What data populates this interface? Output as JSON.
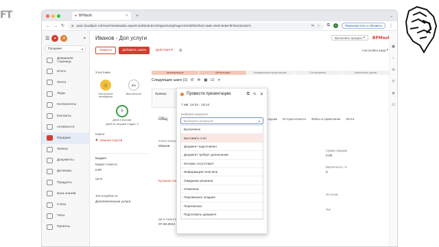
{
  "browser": {
    "tab_title": "BPMsoft",
    "url": "pwd.cloudbpm.ru/0%u0ViewModule.aspx#CardModuleV2/OpportunityPageV2/edit/f40cf643-4a8c-464b-9e66-f675223210a7c",
    "relaunch_label": "Перезапустить и обновить"
  },
  "sidebar": {
    "product_select": "Продажи",
    "items": [
      {
        "label": "Домашняя страница",
        "active": false
      },
      {
        "label": "Итоги",
        "active": false
      },
      {
        "label": "Лента",
        "active": false
      },
      {
        "label": "Лиды",
        "active": false
      },
      {
        "label": "Контрагенты",
        "active": false
      },
      {
        "label": "Контакты",
        "active": false
      },
      {
        "label": "Активности",
        "active": false
      },
      {
        "label": "Продажи",
        "active": true
      },
      {
        "label": "Заказы",
        "active": false
      },
      {
        "label": "Документы",
        "active": false
      },
      {
        "label": "Договоры",
        "active": false
      },
      {
        "label": "Продукты",
        "active": false
      },
      {
        "label": "База знаний",
        "active": false
      },
      {
        "label": "Счета",
        "active": false
      },
      {
        "label": "Чаты",
        "active": false
      },
      {
        "label": "Проекты",
        "active": false
      }
    ]
  },
  "header": {
    "title": "Иванов - Доп услуги",
    "execute_process": "Выполнить процесс",
    "logo": "BPMsoft",
    "close_label": "Закрыть",
    "add_order_label": "Добавить заказ",
    "actions_label": "Действия",
    "view_settings": "Настройка вида"
  },
  "left_panel": {
    "participants_title": "Участники",
    "mood_label": "Настроение менеджера",
    "probability_label": "Вероятность",
    "probability_value": "0%",
    "days_value": "0",
    "days_label": "Дней в воронке",
    "days_stage_label": "Дней на текущей стадии: 0",
    "client_label": "Клиент",
    "client_value": "Иванов Сергей",
    "budget_title": "Бюджет",
    "budget_label": "Бюджет клиента",
    "budget_value": "0,00",
    "price_label": "Цена",
    "need_type_label": "Тип потребности",
    "need_type_value": "Дополнительные услуги"
  },
  "stages": [
    "Квалификация",
    "Презентация",
    "Коммерческое предложение",
    "Согласование",
    "Заключение сделки"
  ],
  "next_steps": {
    "title": "Следующие шаги (1)",
    "small": "Пример"
  },
  "popup": {
    "title": "Провести презентацию",
    "datetime": "7 авг. 14:44 - 15:14",
    "result_label": "Выберите результат",
    "placeholder": "Выберите результат",
    "options": [
      "Выполнено",
      "Выставить счет",
      "Документ подготовлен",
      "Документ требует дополнения",
      "Интерес отсутствует",
      "Информация получена",
      "Ожидание решения",
      "Отменена",
      "Перезвонить позднее",
      "Переписана",
      "Подготовить документ"
    ],
    "hover_index": 1
  },
  "main_fields": {
    "general_info": "Общ",
    "owner_label": "Ответственный",
    "owner_value": "Иванов",
    "contact_value": "Кулаков Сергей",
    "amount_label": "Сумма продажи",
    "amount_value": "0,00",
    "prob_label": "Вероятность, %",
    "prob_value": "0",
    "source_label": "Источник",
    "type_label": "Тип",
    "date_label": "Дата закрытия",
    "date_value": "07.08.2024"
  },
  "tabs": [
    "История продажи",
    "История клиента",
    "Файлы и примечания",
    "Лента"
  ]
}
